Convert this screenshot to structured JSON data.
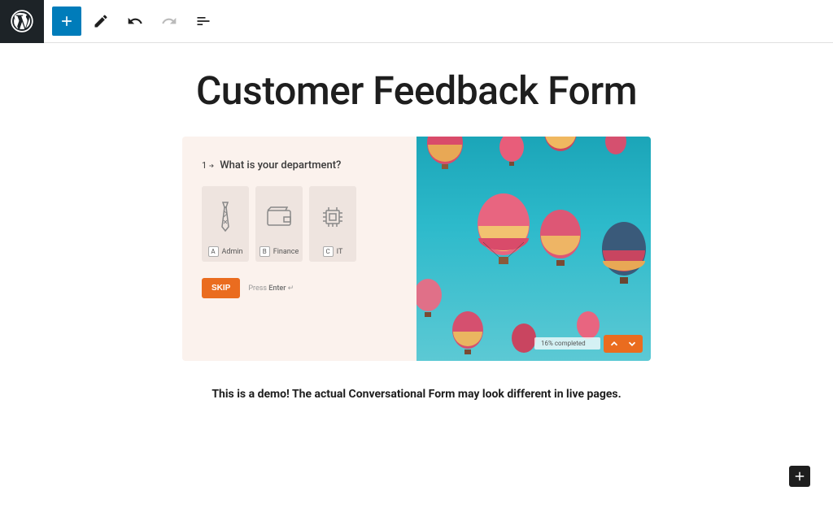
{
  "page": {
    "title": "Customer Feedback Form"
  },
  "form": {
    "question_number": "1",
    "question_text": "What is your department?",
    "options": [
      {
        "key": "A",
        "label": "Admin"
      },
      {
        "key": "B",
        "label": "Finance"
      },
      {
        "key": "C",
        "label": "IT"
      }
    ],
    "skip_label": "SKIP",
    "hint_prefix": "Press ",
    "hint_key": "Enter",
    "hint_suffix": " ↵",
    "progress_text": "16% completed"
  },
  "demo_note": "This is a demo! The actual Conversational Form may look different in live pages."
}
